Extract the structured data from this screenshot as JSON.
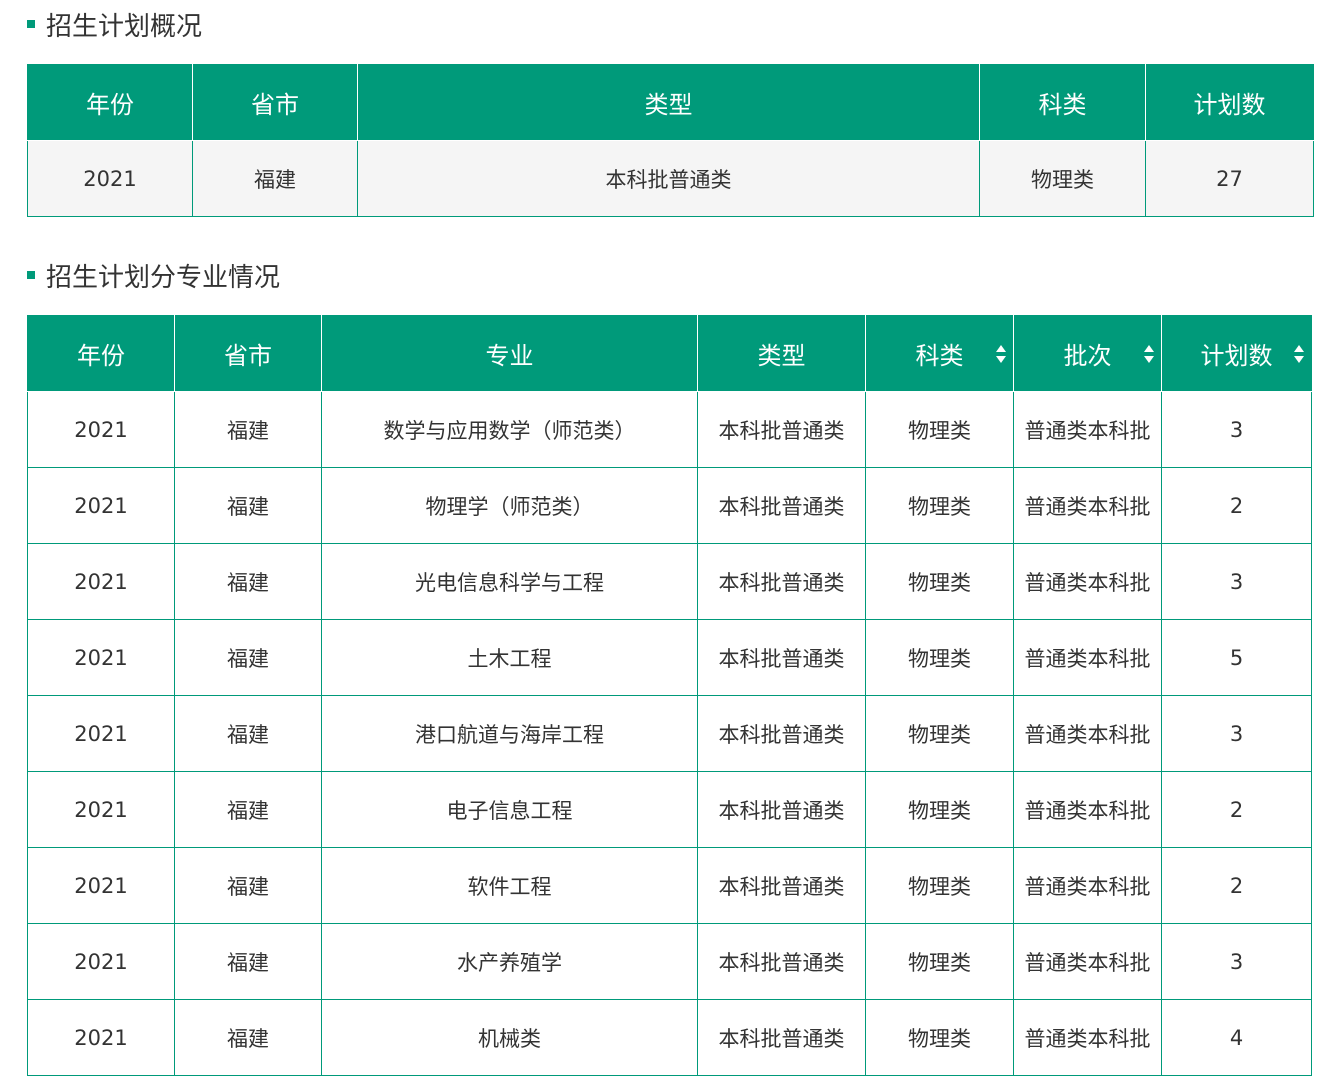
{
  "overview": {
    "title": "招生计划概况",
    "headers": [
      "年份",
      "省市",
      "类型",
      "科类",
      "计划数"
    ],
    "rows": [
      [
        "2021",
        "福建",
        "本科批普通类",
        "物理类",
        "27"
      ]
    ]
  },
  "majors": {
    "title": "招生计划分专业情况",
    "headers": [
      "年份",
      "省市",
      "专业",
      "类型",
      "科类",
      "批次",
      "计划数"
    ],
    "sortable_columns": [
      "科类",
      "批次",
      "计划数"
    ],
    "rows": [
      [
        "2021",
        "福建",
        "数学与应用数学（师范类）",
        "本科批普通类",
        "物理类",
        "普通类本科批",
        "3"
      ],
      [
        "2021",
        "福建",
        "物理学（师范类）",
        "本科批普通类",
        "物理类",
        "普通类本科批",
        "2"
      ],
      [
        "2021",
        "福建",
        "光电信息科学与工程",
        "本科批普通类",
        "物理类",
        "普通类本科批",
        "3"
      ],
      [
        "2021",
        "福建",
        "土木工程",
        "本科批普通类",
        "物理类",
        "普通类本科批",
        "5"
      ],
      [
        "2021",
        "福建",
        "港口航道与海岸工程",
        "本科批普通类",
        "物理类",
        "普通类本科批",
        "3"
      ],
      [
        "2021",
        "福建",
        "电子信息工程",
        "本科批普通类",
        "物理类",
        "普通类本科批",
        "2"
      ],
      [
        "2021",
        "福建",
        "软件工程",
        "本科批普通类",
        "物理类",
        "普通类本科批",
        "2"
      ],
      [
        "2021",
        "福建",
        "水产养殖学",
        "本科批普通类",
        "物理类",
        "普通类本科批",
        "3"
      ],
      [
        "2021",
        "福建",
        "机械类",
        "本科批普通类",
        "物理类",
        "普通类本科批",
        "4"
      ]
    ]
  },
  "colors": {
    "accent": "#009a7a",
    "text": "#333333",
    "overview_row_bg": "#f5f5f5"
  }
}
